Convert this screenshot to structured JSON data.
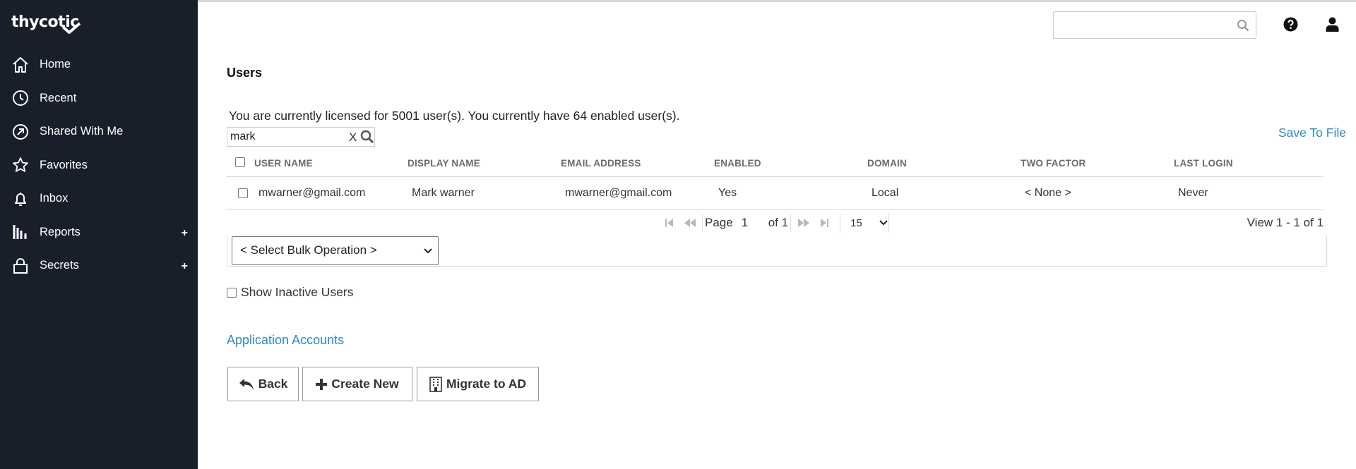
{
  "brand": {
    "logo_text": "thycotic"
  },
  "sidebar": {
    "items": [
      {
        "label": "Home",
        "icon": "home-icon",
        "expandable": false
      },
      {
        "label": "Recent",
        "icon": "clock-icon",
        "expandable": false
      },
      {
        "label": "Shared With Me",
        "icon": "shared-icon",
        "expandable": false
      },
      {
        "label": "Favorites",
        "icon": "star-icon",
        "expandable": false
      },
      {
        "label": "Inbox",
        "icon": "bell-icon",
        "expandable": false
      },
      {
        "label": "Reports",
        "icon": "reports-icon",
        "expandable": true,
        "expand_symbol": "+"
      },
      {
        "label": "Secrets",
        "icon": "lock-icon",
        "expandable": true,
        "expand_symbol": "+"
      }
    ]
  },
  "header": {
    "search_value": "",
    "search_placeholder": "",
    "search_icon": "search-icon",
    "help_icon": "help-circle-icon",
    "user_icon": "user-icon"
  },
  "main": {
    "title": "Users",
    "license_text": "You are currently licensed for 5001 user(s). You currently have 64 enabled user(s).",
    "filter": {
      "value": "mark",
      "clear_label": "X"
    },
    "save_to_file": "Save To File",
    "table": {
      "columns": [
        "USER NAME",
        "DISPLAY NAME",
        "EMAIL ADDRESS",
        "ENABLED",
        "DOMAIN",
        "TWO FACTOR",
        "LAST LOGIN"
      ],
      "rows": [
        {
          "user_name": "mwarner@gmail.com",
          "display_name": "Mark warner",
          "email": "mwarner@gmail.com",
          "enabled": "Yes",
          "domain": "Local",
          "two_factor": "< None >",
          "last_login": "Never"
        }
      ]
    },
    "pager": {
      "page_label": "Page",
      "page_value": "1",
      "of_label": "of 1",
      "page_size": "15",
      "view_text": "View 1 - 1 of 1"
    },
    "bulk_operation": "< Select Bulk Operation >",
    "show_inactive_label": "Show Inactive Users",
    "application_accounts": "Application Accounts",
    "buttons": {
      "back": "Back",
      "create_new": "Create New",
      "migrate": "Migrate to AD"
    }
  },
  "colors": {
    "sidebar_bg": "#191e2b",
    "link": "#2d87c8"
  }
}
